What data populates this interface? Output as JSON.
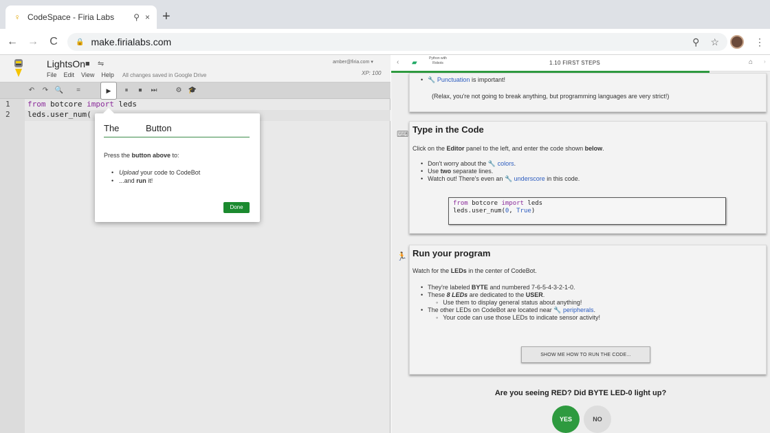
{
  "browser": {
    "tab_title": "CodeSpace - Firia Labs",
    "tab_media": "⚲",
    "tab_close": "×",
    "new_tab": "+",
    "url": "make.firialabs.com",
    "back": "←",
    "forward": "→",
    "reload": "C",
    "lock": "🔒"
  },
  "editor": {
    "project_name": "LightsOn",
    "menu": [
      "File",
      "Edit",
      "View",
      "Help"
    ],
    "saved_status": "All changes saved in Google Drive",
    "user_email": "amber@firia.com ▾",
    "xp": "XP: 100",
    "toolbar_icons": [
      "↶",
      "↷",
      "🔍",
      "=",
      "▶",
      "⏸",
      "⏹",
      "⏭",
      "⚙",
      "🎓"
    ],
    "code_lines": [
      {
        "num": "1",
        "pre": "from",
        "mid": " botcore ",
        "kw": "import",
        "post": " leds"
      },
      {
        "num": "2",
        "text": "leds.user_num("
      }
    ]
  },
  "popup": {
    "title_a": "The",
    "title_b": "Button",
    "body_a": "Press the ",
    "body_b": "button above",
    "body_c": " to:",
    "item1_a": "Upload",
    "item1_b": " your code to CodeBot",
    "item2_a": "...and ",
    "item2_b": "run",
    "item2_c": " it!",
    "done": "Done"
  },
  "lesson": {
    "course": "Python with Robots",
    "title": "1.10 FIRST STEPS",
    "progress_fraction": 0.84,
    "card1": {
      "bullet_link": "Punctuation",
      "bullet_rest": " is important!",
      "note": "(Relax, you're not going to break anything, but programming languages are very strict!)"
    },
    "card2": {
      "heading": "Type in the Code",
      "intro_a": "Click on the ",
      "intro_b": "Editor",
      "intro_c": " panel to the left, and enter the code shown ",
      "intro_d": "below",
      "intro_e": ".",
      "b1_a": "Don't worry about the ",
      "b1_link": "colors",
      "b1_b": ".",
      "b2_a": "Use ",
      "b2_b": "two",
      "b2_c": " separate lines.",
      "b3_a": "Watch out! There's even an ",
      "b3_link": "underscore",
      "b3_b": " in this code.",
      "code1_a": "from",
      "code1_b": " botcore ",
      "code1_c": "import",
      "code1_d": " leds",
      "code2_a": "leds.user_num(",
      "code2_b": "0",
      "code2_c": ", ",
      "code2_d": "True",
      "code2_e": ")"
    },
    "card3": {
      "heading": "Run your program",
      "intro_a": "Watch for the ",
      "intro_b": "LEDs",
      "intro_c": " in the center of CodeBot.",
      "b1_a": "They're labeled ",
      "b1_b": "BYTE",
      "b1_c": " and numbered 7-6-5-4-3-2-1-0.",
      "b2_a": "These ",
      "b2_b": "8 LEDs",
      "b2_c": " are dedicated to the ",
      "b2_d": "USER",
      "b2_e": ".",
      "b2_sub": "Use them to display general status about anything!",
      "b3_a": "The other LEDs on CodeBot are located near ",
      "b3_link": "peripherals",
      "b3_b": ".",
      "b3_sub": "Your code can use those LEDs to indicate sensor activity!",
      "button": "SHOW ME HOW TO RUN THE CODE..."
    },
    "question": "Are you seeing RED? Did BYTE LED-0 light up?",
    "yes": "YES",
    "no": "NO"
  }
}
